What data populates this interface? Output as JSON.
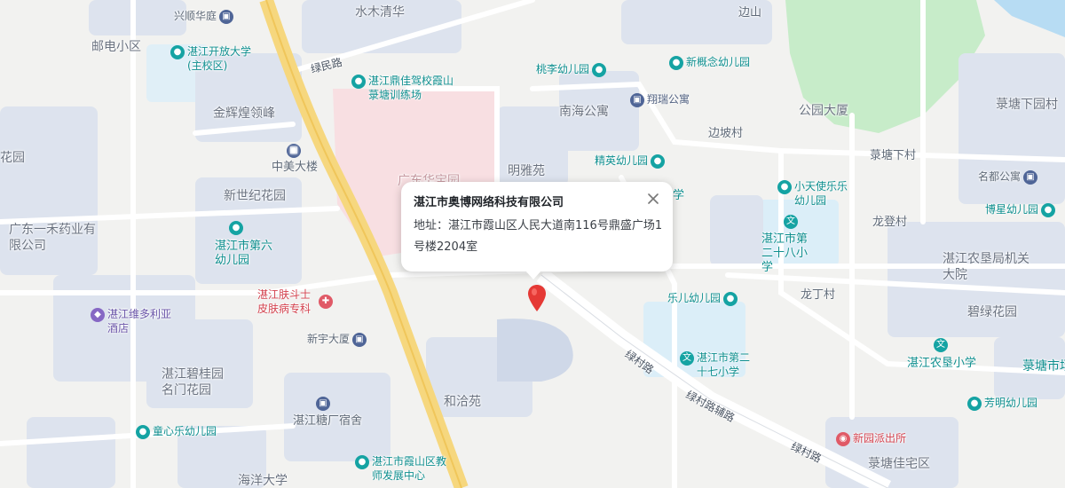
{
  "popup": {
    "title": "湛江市奥博网络科技有限公司",
    "address": "地址：湛江市霞山区人民大道南116号鼎盛广场1号楼2204室"
  },
  "icons": {
    "close": "close-icon",
    "marker": "map-pin-icon",
    "school": "school-icon",
    "kindergarten": "kindergarten-icon",
    "building": "building-icon",
    "hospital": "hospital-icon",
    "hotel": "hotel-icon",
    "police": "police-icon",
    "poi": "location-pin-icon"
  },
  "colors": {
    "marker": "#e53935",
    "education": "#15a3a3",
    "building": "#4f6597",
    "medical": "#e05a67",
    "hotel": "#8667c4",
    "main_road": "#f6d77e"
  },
  "labels": {
    "xingshun": "兴顺华庭",
    "shuimu": "水木清华",
    "biansha": "边山",
    "youdian": "邮电小区",
    "zhanjiang_open_univ": "湛江开放大学(主校区)",
    "lvmin_road": "绿民路",
    "dingjia": "湛江鼎佳驾校霞山菉塘训练场",
    "taoli": "桃李幼儿园",
    "xingainian": "新概念幼儿园",
    "xiangrui": "翔瑞公寓",
    "nanhai": "南海公寓",
    "gongyuan_dasha": "公园大厦",
    "jintang_xia": "菉塘下园村",
    "jinhui": "金辉煌领峰",
    "zhongmei": "中美大楼",
    "bianpo": "边坡村",
    "mingya": "明雅苑",
    "jingying": "精英幼儿园",
    "jintangxia": "菉塘下村",
    "huayuan": "花园",
    "xinshiji": "新世纪花园",
    "guangdong_yiyuan": "广东华宝园",
    "xiaotianshi": "小天使乐乐幼儿园",
    "mingdu": "名都公寓",
    "guangdong_yihe": "广东一禾药业有限公司",
    "diliu_kg": "湛江市第六幼儿园",
    "di28": "湛江市第二十八小学",
    "bobing": "博星幼儿园",
    "longdeng": "龙登村",
    "nongken_ju": "湛江农垦局机关大院",
    "pifu": "湛江肤斗士皮肤病专科",
    "weiduoliya": "湛江维多利亚酒店",
    "xinyu": "新宇大厦",
    "longding": "龙丁村",
    "leer": "乐儿幼儿园",
    "bilv": "碧绿花园",
    "nongken_xiaoxue": "湛江农垦小学",
    "bigui": "湛江碧桂园名门花园",
    "di27": "湛江市第二十七小学",
    "lvcun_road1": "绿村路",
    "lvcun_fu": "绿村路辅路",
    "jintang_shi": "菉塘市场",
    "heqia": "和洽苑",
    "tangchang": "湛江糖厂宿舍",
    "fangming": "芳明幼儿园",
    "tongxin": "童心乐幼儿园",
    "xinyuan_pcs": "新园派出所",
    "lvcun_road2": "绿村路",
    "jiaoshi": "湛江市霞山区教师发展中心",
    "jintang_jia": "菉塘佳宅区",
    "haiyang": "海洋大学",
    "xiao": "小学"
  }
}
